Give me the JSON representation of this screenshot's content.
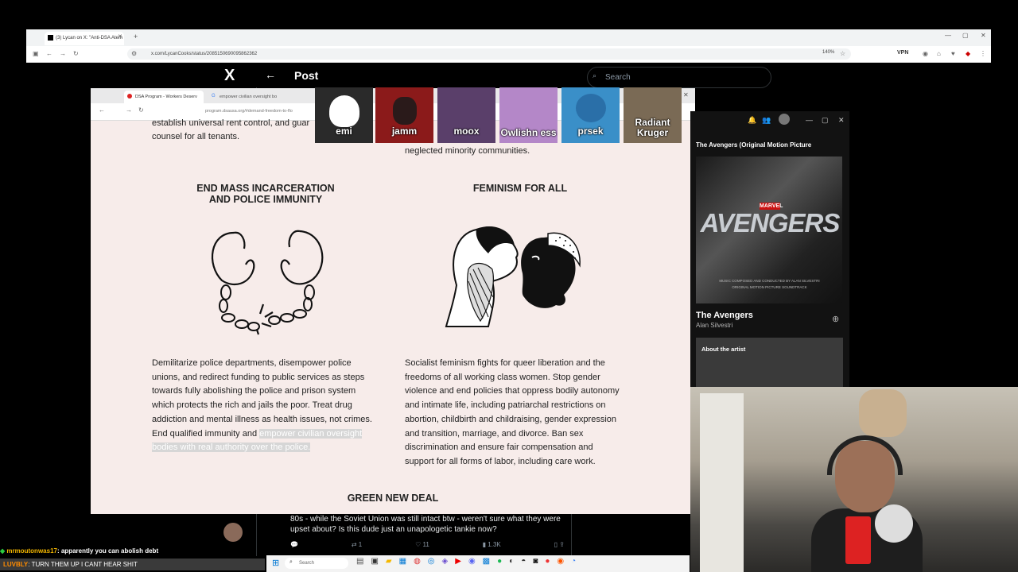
{
  "outer_browser": {
    "tab_title": "(3) Lycan on X: \"Anti-DSA Atem",
    "url": "x.com/LycanCooks/status/2085150690095862362",
    "zoom": "140%",
    "vpn_label": "VPN"
  },
  "x_page": {
    "logo": "X",
    "back_arrow": "←",
    "title": "Post",
    "search_placeholder": "Search",
    "tweet_text": "80s - while the Soviet Union was still intact btw - weren't sure what they were upset about? Is this dude just an unapologetic tankie now?",
    "actions": {
      "replies": "",
      "reposts": "1",
      "likes": "11",
      "views": "1.3K"
    }
  },
  "inner_browser": {
    "tab1_title": "DSA Program - Workers Deserv",
    "tab2_title": "empower civilian oversight bo",
    "url": "program.dsausa.org/#demand-freedom-to-flo"
  },
  "document": {
    "top_left_text": "establish universal rent control, and guar... counsel for all tenants.",
    "top_left_line1": "establish universal rent control, and guar",
    "top_left_line2": "counsel for all tenants.",
    "top_right_line1": "neglected minority communities.",
    "sections": [
      {
        "heading_line1": "END MASS INCARCERATION",
        "heading_line2": "AND POLICE IMMUNITY",
        "body_lines": [
          "Demilitarize police departments, disempower police",
          "unions, and redirect funding to public services as steps",
          "towards fully abolishing the police and prison system",
          "which protects the rich and jails the poor. Treat drug",
          "addiction and mental illness as health issues, not crimes."
        ],
        "body_last_plain": "End qualified immunity and ",
        "body_highlight1": "empower civilian oversight",
        "body_highlight2": "bodies with real authority over the police."
      },
      {
        "heading": "FEMINISM FOR ALL",
        "body_lines": [
          "Socialist feminism fights for queer liberation and the",
          "freedoms of all working class women. Stop gender",
          "violence and end policies that oppress bodily autonomy",
          "and intimate life, including patriarchal restrictions on",
          "abortion, childbirth and childraising, gender expression",
          "and transition, marriage, and divorce. Ban sex",
          "discrimination and ensure fair compensation and",
          "support for all forms of labor, including care work."
        ]
      }
    ],
    "next_heading": "GREEN NEW DEAL"
  },
  "avatars": [
    {
      "name": "emi",
      "color": "#2a2a2a"
    },
    {
      "name": "jamm",
      "color": "#8b1a1a"
    },
    {
      "name": "moox",
      "color": "#5a3f6a"
    },
    {
      "name": "Owlishn ess",
      "color": "#b487c8"
    },
    {
      "name": "prsek",
      "color": "#3a8fc8"
    },
    {
      "name": "Radiant Kruger",
      "color": "#7a6a55"
    }
  ],
  "spotify": {
    "panel_title": "The Avengers (Original Motion Picture",
    "cover_text": "AVENGERS",
    "cover_brand": "MARVEL",
    "cover_credit": "MUSIC COMPOSED AND CONDUCTED BY ALAN SILVESTRI",
    "cover_sub": "ORIGINAL MOTION PICTURE SOUNDTRACK",
    "album_title": "The Avengers",
    "artist": "Alan Silvestri",
    "about_label": "About the artist"
  },
  "chat": {
    "line1_user": "mrmoutonwas17",
    "line1_text": ": apparently you can abolish debt",
    "line2_user": "LUVBLY",
    "line2_text": ": TURN THEM UP I CANT HEAR SHIT"
  },
  "taskbar": {
    "search_label": "Search"
  }
}
